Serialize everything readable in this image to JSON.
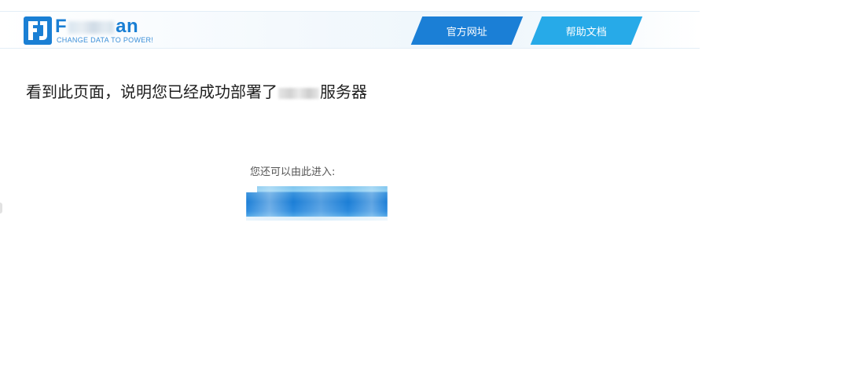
{
  "header": {
    "logo": {
      "word_start": "F",
      "word_end": "an",
      "tagline": "CHANGE DATA TO POWER!",
      "brand_color": "#1a7fd4"
    },
    "nav": [
      {
        "label": "官方网址",
        "color": "#1b7fd6"
      },
      {
        "label": "帮助文档",
        "color": "#27aae8"
      }
    ]
  },
  "main": {
    "headline_start": "看到此页面，说明您已经成功部署了",
    "headline_end": "服务器",
    "enter_label": "您还可以由此进入:"
  }
}
